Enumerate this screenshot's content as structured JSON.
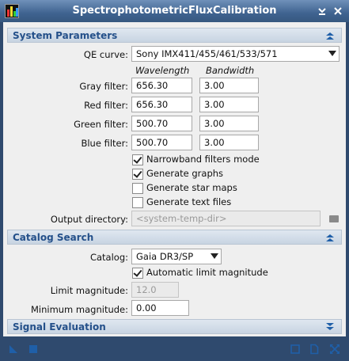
{
  "window": {
    "title": "SpectrophotometricFluxCalibration"
  },
  "system_parameters": {
    "title": "System Parameters",
    "qe_curve": {
      "label": "QE curve:",
      "value": "Sony IMX411/455/461/533/571"
    },
    "headers": {
      "wavelength": "Wavelength",
      "bandwidth": "Bandwidth"
    },
    "filters": [
      {
        "label": "Gray filter:",
        "wavelength": "656.30",
        "bandwidth": "3.00"
      },
      {
        "label": "Red filter:",
        "wavelength": "656.30",
        "bandwidth": "3.00"
      },
      {
        "label": "Green filter:",
        "wavelength": "500.70",
        "bandwidth": "3.00"
      },
      {
        "label": "Blue filter:",
        "wavelength": "500.70",
        "bandwidth": "3.00"
      }
    ],
    "options": [
      {
        "label": "Narrowband filters mode",
        "checked": true
      },
      {
        "label": "Generate graphs",
        "checked": true
      },
      {
        "label": "Generate star maps",
        "checked": false
      },
      {
        "label": "Generate text files",
        "checked": false
      }
    ],
    "output_directory": {
      "label": "Output directory:",
      "placeholder": "<system-temp-dir>"
    }
  },
  "catalog_search": {
    "title": "Catalog Search",
    "catalog": {
      "label": "Catalog:",
      "value": "Gaia DR3/SP"
    },
    "auto_limit": {
      "label": "Automatic limit magnitude",
      "checked": true
    },
    "limit_magnitude": {
      "label": "Limit magnitude:",
      "value": "12.0"
    },
    "minimum_magnitude": {
      "label": "Minimum magnitude:",
      "value": "0.00"
    }
  },
  "signal_evaluation": {
    "title": "Signal Evaluation"
  },
  "colors": {
    "title_bar": "#3f6390",
    "section_text": "#24508a",
    "icon_blue": "#1f5fa8"
  }
}
